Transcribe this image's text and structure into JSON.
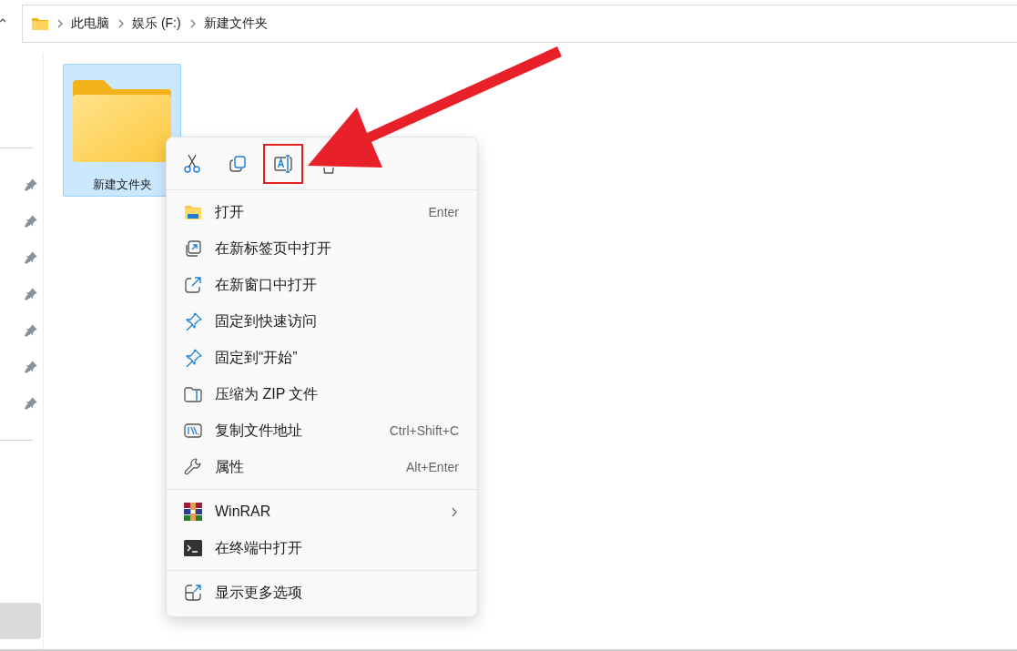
{
  "address_bar": {
    "segments": [
      "此电脑",
      "娱乐 (F:)",
      "新建文件夹"
    ]
  },
  "files": [
    {
      "name": "新建文件夹",
      "selected": true
    }
  ],
  "context_menu": {
    "toolbar": [
      {
        "highlighted": false
      },
      {
        "highlighted": false
      },
      {
        "highlighted": true
      },
      {
        "highlighted": false
      }
    ],
    "groups": [
      [
        {
          "label": "打开",
          "shortcut": "Enter",
          "submenu": false
        },
        {
          "label": "在新标签页中打开",
          "submenu": false
        },
        {
          "label": "在新窗口中打开",
          "submenu": false
        },
        {
          "label": "固定到快速访问",
          "submenu": false
        },
        {
          "label": "固定到“开始”",
          "submenu": false
        },
        {
          "label": "压缩为 ZIP 文件",
          "submenu": false
        },
        {
          "label": "复制文件地址",
          "shortcut": "Ctrl+Shift+C",
          "submenu": false
        },
        {
          "label": "属性",
          "shortcut": "Alt+Enter",
          "submenu": false
        }
      ],
      [
        {
          "label": "WinRAR",
          "submenu": true
        },
        {
          "label": "在终端中打开",
          "submenu": false
        }
      ],
      [
        {
          "label": "显示更多选项",
          "submenu": false
        }
      ]
    ]
  }
}
